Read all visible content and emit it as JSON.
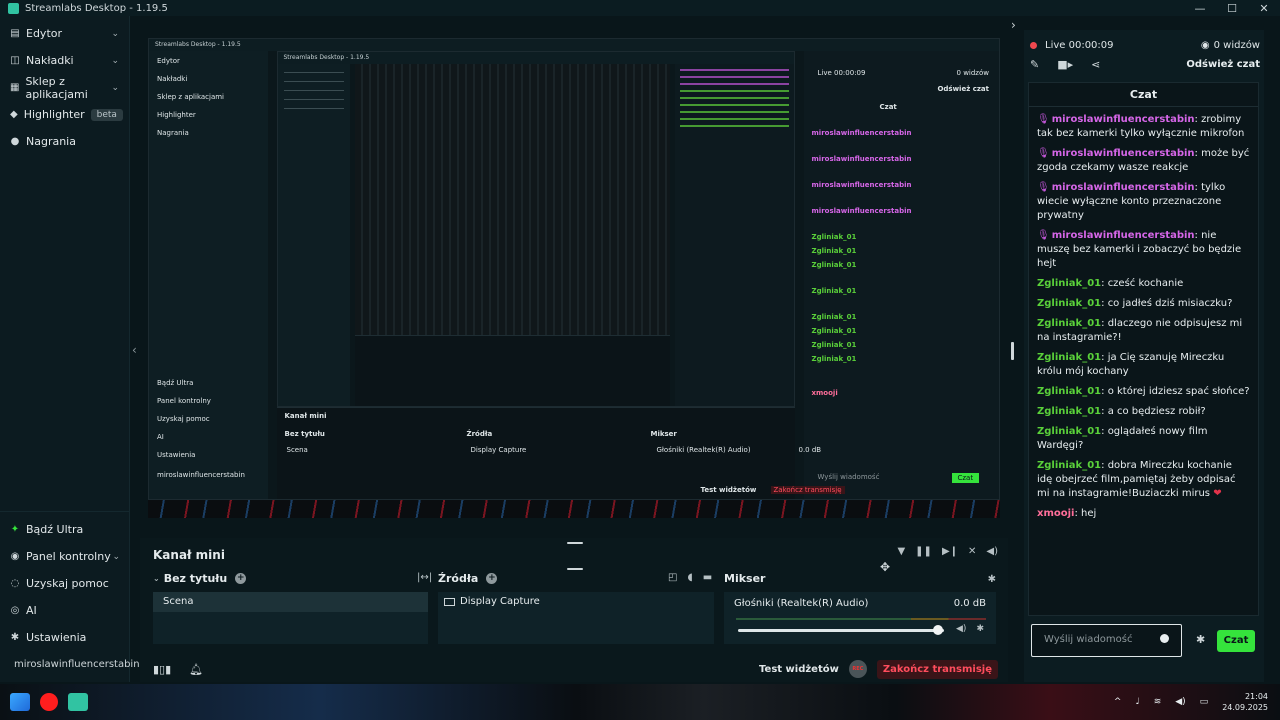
{
  "window": {
    "title": "Streamlabs Desktop - 1.19.5",
    "min": "—",
    "max": "☐",
    "close": "✕"
  },
  "sidebar": {
    "items": [
      {
        "label": "Edytor",
        "icon": "editor-icon",
        "chev": "⌄"
      },
      {
        "label": "Nakładki",
        "icon": "overlays-icon",
        "chev": "⌄"
      },
      {
        "label": "Sklep z aplikacjami",
        "icon": "appstore-icon",
        "chev": "⌄"
      },
      {
        "label": "Highlighter",
        "icon": "highlighter-icon",
        "badge": "beta"
      },
      {
        "label": "Nagrania",
        "icon": "recordings-icon"
      }
    ],
    "bottom": [
      {
        "label": "Bądź Ultra",
        "icon": "ultra-icon"
      },
      {
        "label": "Panel kontrolny",
        "icon": "dashboard-icon",
        "chev": "⌄"
      },
      {
        "label": "Uzyskaj pomoc",
        "icon": "help-icon"
      },
      {
        "label": "AI",
        "icon": "ai-icon"
      },
      {
        "label": "Ustawienia",
        "icon": "settings-icon"
      }
    ],
    "user": "miroslawinfluencerstabin"
  },
  "editor": {
    "mini_title": "Kanał mini",
    "scenes_title": "Bez tytułu",
    "scene_item": "Scena",
    "sources_title": "Źródła",
    "source_item": "Display Capture",
    "mixer_title": "Mikser",
    "mixer_channel": "Głośniki (Realtek(R) Audio)",
    "mixer_db": "0.0 dB",
    "mixer_level": 0.97
  },
  "footer": {
    "test_widgets": "Test widżetów",
    "rec": "REC",
    "end_stream": "Zakończ transmisję"
  },
  "chat": {
    "live": "Live 00:00:09",
    "viewers": "0 widzów",
    "refresh": "Odśwież czat",
    "title": "Czat",
    "messages": [
      {
        "user": "miroslawinfluencerstabin",
        "color": "purple",
        "mod": true,
        "text": ": zrobimy tak bez kamerki tylko wyłącznie mikrofon"
      },
      {
        "user": "miroslawinfluencerstabin",
        "color": "purple",
        "mod": true,
        "text": ": może być zgoda czekamy wasze reakcje"
      },
      {
        "user": "miroslawinfluencerstabin",
        "color": "purple",
        "mod": true,
        "text": ": tylko wiecie wyłączne konto przeznaczone prywatny"
      },
      {
        "user": "miroslawinfluencerstabin",
        "color": "purple",
        "mod": true,
        "text": ": nie muszę bez kamerki i zobaczyć bo będzie hejt"
      },
      {
        "user": "Zgliniak_01",
        "color": "green",
        "text": ": cześć kochanie"
      },
      {
        "user": "Zgliniak_01",
        "color": "green",
        "text": ": co jadłeś dziś misiaczku?"
      },
      {
        "user": "Zgliniak_01",
        "color": "green",
        "text": ": dlaczego nie odpisujesz mi na instagramie?!"
      },
      {
        "user": "Zgliniak_01",
        "color": "green",
        "text": ": ja Cię szanuję Mireczku królu mój kochany"
      },
      {
        "user": "Zgliniak_01",
        "color": "green",
        "text": ": o której idziesz spać słońce?"
      },
      {
        "user": "Zgliniak_01",
        "color": "green",
        "text": ": a co będziesz robił?"
      },
      {
        "user": "Zgliniak_01",
        "color": "green",
        "text": ": oglądałeś nowy film Wardęgi?"
      },
      {
        "user": "Zgliniak_01",
        "color": "green",
        "text": ": dobra Mireczku kochanie idę obejrzeć film,pamiętaj żeby odpisać mi na instagramie!Buziaczki mirus",
        "heart": "❤"
      },
      {
        "user": "xmooji",
        "color": "pink",
        "text": ": hej"
      }
    ],
    "input_placeholder": "Wyślij wiadomość",
    "send": "Czat"
  },
  "taskbar": {
    "time": "21:04",
    "date": "24.09.2025"
  },
  "colors": {
    "accent": "#35e33c",
    "live": "#f0484f",
    "end": "#ff4d5d",
    "mod": "#d566e7",
    "user": "#5ad13a"
  }
}
